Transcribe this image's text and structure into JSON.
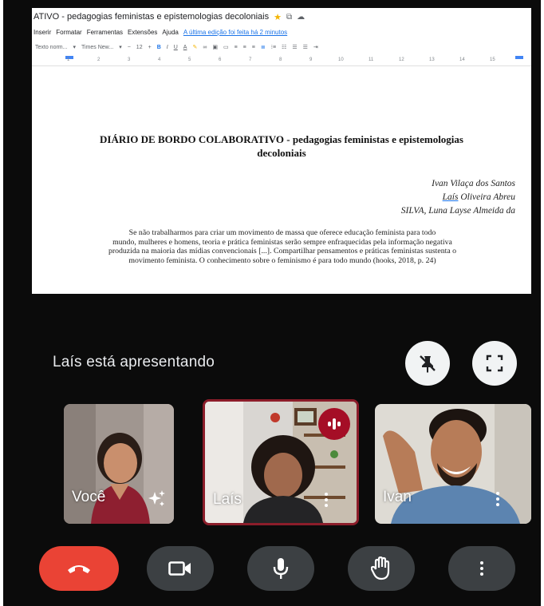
{
  "document": {
    "app_title": "ATIVO - pedagogias feministas e epistemologias decoloniais",
    "menu": [
      "Inserir",
      "Formatar",
      "Ferramentas",
      "Extensões",
      "Ajuda"
    ],
    "last_edit": "A última edição foi feita há 2 minutos",
    "toolbar": {
      "style_select": "Texto norm...",
      "font_select": "Times New...",
      "font_size": "12",
      "bold": "B",
      "italic": "I",
      "underline": "U",
      "text_color": "A"
    },
    "ruler_numbers": [
      "1",
      "2",
      "3",
      "4",
      "5",
      "6",
      "7",
      "8",
      "9",
      "10",
      "11",
      "12",
      "13",
      "14",
      "15"
    ],
    "title_line1": "DIÁRIO DE BORDO COLABORATIVO - pedagogias feministas e epistemologias",
    "title_line2": "decoloniais",
    "authors": {
      "author1": "Ivan Vilaça dos Santos",
      "author2_first": "Laís",
      "author2_rest": " Oliveira Abreu",
      "author3": "SILVA, Luna Layse Almeida da"
    },
    "quote": {
      "line1": "Se não trabalharmos para criar um movimento de massa que oferece educação feminista para todo",
      "line2": "mundo, mulheres e homens, teoria e prática feministas serão sempre enfraquecidas pela informação negativa",
      "line3": "produzida na maioria das mídias convencionais [...]. Compartilhar pensamentos e práticas feministas sustenta o",
      "line4": "movimento feminista. O conhecimento sobre o feminismo é para todo mundo (hooks, 2018, p. 24)"
    }
  },
  "meeting": {
    "presenting_label": "Laís está apresentando",
    "participants": [
      {
        "name": "Você"
      },
      {
        "name": "Laís"
      },
      {
        "name": "Ivan"
      }
    ]
  },
  "colors": {
    "end_call": "#ea4335",
    "control_bg": "#3c4043",
    "speaking_border": "#8c1d2a",
    "speaking_badge": "#a50e26"
  },
  "icons": {
    "presentation_toggle": "pin-off-icon",
    "fullscreen": "fullscreen-icon",
    "effects": "sparkle-icon",
    "speaking": "audio-level-icon",
    "end_call": "phone-hangup-icon",
    "camera": "videocam-icon",
    "microphone": "mic-icon",
    "raise_hand": "hand-icon",
    "more": "more-vert-icon"
  }
}
